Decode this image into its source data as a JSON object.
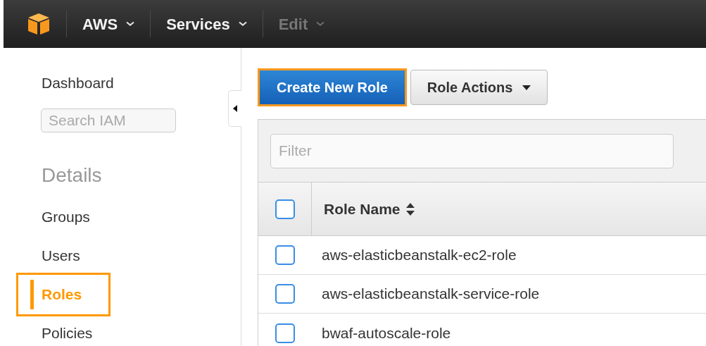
{
  "top_bar": {
    "menus": [
      {
        "label": "AWS",
        "disabled": false
      },
      {
        "label": "Services",
        "disabled": false
      },
      {
        "label": "Edit",
        "disabled": true
      }
    ]
  },
  "sidebar": {
    "dashboard": "Dashboard",
    "search": {
      "placeholder": "Search IAM"
    },
    "section_title": "Details",
    "items": [
      {
        "label": "Groups",
        "selected": false
      },
      {
        "label": "Users",
        "selected": false
      },
      {
        "label": "Roles",
        "selected": true
      },
      {
        "label": "Policies",
        "selected": false
      }
    ]
  },
  "toolbar": {
    "primary_button": "Create New Role",
    "actions_button": "Role Actions"
  },
  "table": {
    "filter": {
      "placeholder": "Filter"
    },
    "select_all_checked": false,
    "columns": [
      "Role Name"
    ],
    "rows": [
      {
        "name": "aws-elasticbeanstalk-ec2-role",
        "checked": false
      },
      {
        "name": "aws-elasticbeanstalk-service-role",
        "checked": false
      },
      {
        "name": "bwaf-autoscale-role",
        "checked": false
      }
    ]
  }
}
